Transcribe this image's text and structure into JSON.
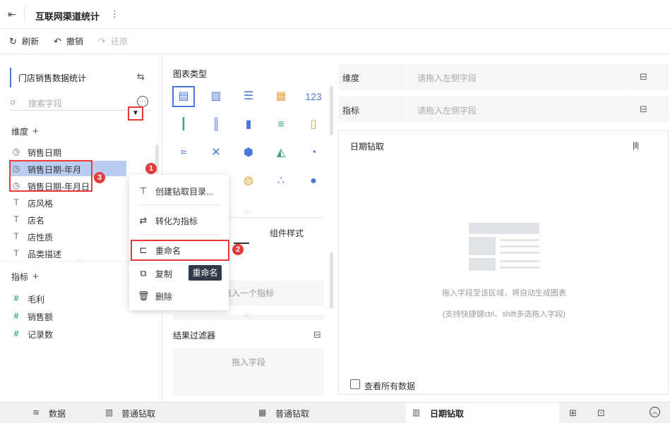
{
  "header": {
    "back_icon": "exit-icon",
    "title": "互联网渠道统计",
    "more_icon": "⋮"
  },
  "toolbar": {
    "refresh": "刷新",
    "undo": "撤销",
    "redo": "还原"
  },
  "left": {
    "dataset": "门店销售数据统计",
    "search_placeholder": "搜索字段",
    "dims_label": "维度",
    "dimensions": [
      {
        "label": "销售日期",
        "icon": "clock-icon"
      },
      {
        "label": "销售日期-年月",
        "icon": "clock-icon",
        "selected": true
      },
      {
        "label": "销售日期-年月日",
        "icon": "clock-icon"
      },
      {
        "label": "店风格",
        "icon": "text-icon"
      },
      {
        "label": "店名",
        "icon": "text-icon"
      },
      {
        "label": "店性质",
        "icon": "text-icon"
      },
      {
        "label": "品类描述",
        "icon": "text-icon"
      }
    ],
    "measures_label": "指标",
    "measures": [
      {
        "label": "毛利",
        "icon": "hash-icon"
      },
      {
        "label": "销售额",
        "icon": "hash-icon"
      },
      {
        "label": "记录数",
        "icon": "hash-icon"
      }
    ],
    "badges": {
      "one": "1",
      "two": "2",
      "three": "3"
    }
  },
  "menu": {
    "items": [
      {
        "label": "创建钻取目录...",
        "icon": "tree-icon"
      },
      {
        "label": "转化为指标",
        "icon": "swap-icon"
      },
      {
        "label": "重命名",
        "icon": "rename-icon"
      },
      {
        "label": "复制",
        "icon": "copy-icon"
      },
      {
        "label": "删除",
        "icon": "trash-icon"
      }
    ],
    "tooltip": "重命名"
  },
  "middle": {
    "chart_type_title": "图表类型",
    "tab_attr": "",
    "tab_style": "组件样式",
    "measure_drop": "拖入一个指标",
    "result_filter": "结果过滤器",
    "filter_drop": "拖入字段"
  },
  "right": {
    "dim_label": "维度",
    "dim_placeholder": "请拖入左侧字段",
    "measure_label": "指标",
    "measure_placeholder": "请拖入左侧字段",
    "canvas_title": "日期钻取",
    "hint1": "拖入字段至该区域，将自动生成图表",
    "hint2": "(支持快捷键ctrl、shift多选拖入字段)",
    "show_all": "查看所有数据"
  },
  "bottom": {
    "tabs": [
      {
        "label": "数据",
        "icon": "database-icon"
      },
      {
        "label": "普通钻取",
        "icon": "chart-icon"
      },
      {
        "label": "普通钻取",
        "icon": "dashboard-icon"
      },
      {
        "label": "日期钻取",
        "icon": "chart-icon",
        "active": true
      }
    ]
  }
}
